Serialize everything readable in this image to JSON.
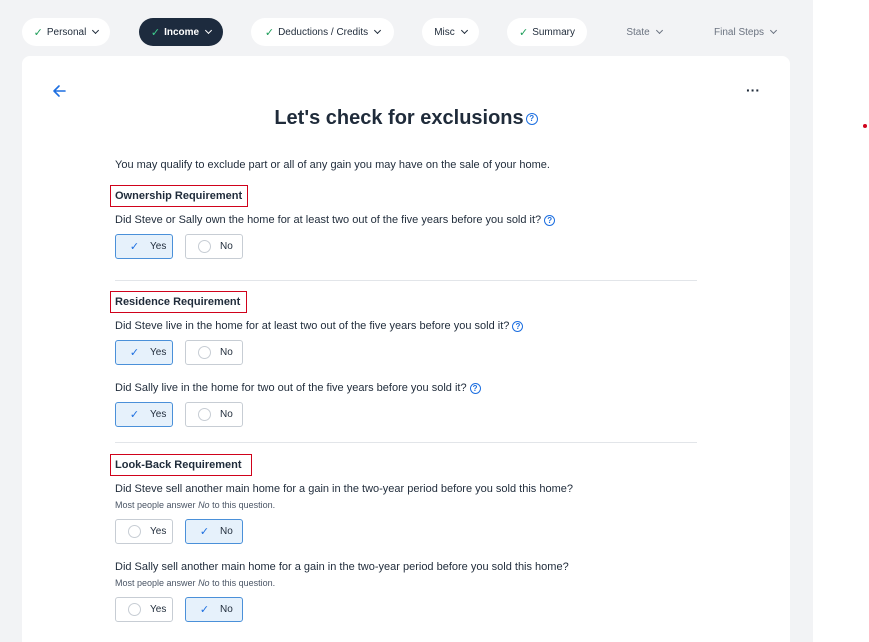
{
  "nav": {
    "items": [
      {
        "label": "Personal",
        "checked": true,
        "state": "default"
      },
      {
        "label": "Income",
        "checked": true,
        "state": "active"
      },
      {
        "label": "Deductions / Credits",
        "checked": true,
        "state": "default"
      },
      {
        "label": "Misc",
        "checked": false,
        "state": "default"
      },
      {
        "label": "Summary",
        "checked": true,
        "state": "default"
      },
      {
        "label": "State",
        "checked": false,
        "state": "plain"
      },
      {
        "label": "Final Steps",
        "checked": false,
        "state": "plain"
      }
    ]
  },
  "page": {
    "title": "Let's check for exclusions",
    "intro": "You may qualify to exclude part or all of any gain you may have on the sale of your home."
  },
  "sections": [
    {
      "heading": "Ownership Requirement",
      "questions": [
        {
          "text": "Did Steve or Sally own the home for at least two out of the five years before you sold it?",
          "help": true,
          "selected": "Yes"
        }
      ]
    },
    {
      "heading": "Residence Requirement",
      "questions": [
        {
          "text": "Did Steve live in the home for at least two out of the five years before you sold it?",
          "help": true,
          "selected": "Yes"
        },
        {
          "text": "Did Sally live in the home for two out of the five years before you sold it?",
          "help": true,
          "selected": "Yes"
        }
      ]
    },
    {
      "heading": "Look-Back Requirement",
      "questions": [
        {
          "text": "Did Steve sell another main home for a gain in the two-year period before you sold this home?",
          "hint_pre": "Most people answer",
          "hint_em": "No",
          "hint_post": "to this question.",
          "selected": "No"
        },
        {
          "text": "Did Sally sell another main home for a gain in the two-year period before you sold this home?",
          "hint_pre": "Most people answer",
          "hint_em": "No",
          "hint_post": "to this question.",
          "selected": "No"
        }
      ]
    }
  ],
  "options": {
    "yes": "Yes",
    "no": "No"
  },
  "icons": {
    "help": "?",
    "check": "✓",
    "more": "···"
  },
  "colors": {
    "nav_active": "#1d2b3e",
    "accent": "#1d6fe0",
    "check_green": "#1e9e5a",
    "highlight_box": "#d0021b",
    "selected_bg": "#e6f1fb"
  }
}
